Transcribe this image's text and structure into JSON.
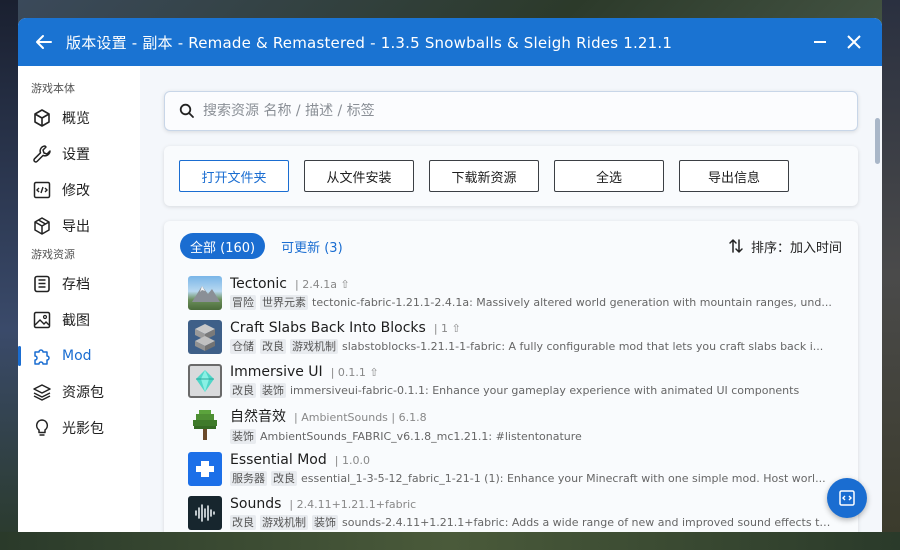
{
  "window": {
    "title": "版本设置 - 副本 - Remade & Remastered - 1.3.5 Snowballs & Sleigh Rides 1.21.1"
  },
  "colors": {
    "accent": "#1a6dd1",
    "titlebar": "#1a73d2"
  },
  "sidebar": {
    "group1": "游戏本体",
    "group2": "游戏资源",
    "items": [
      {
        "label": "概览",
        "icon": "cube-icon"
      },
      {
        "label": "设置",
        "icon": "wrench-icon"
      },
      {
        "label": "修改",
        "icon": "code-file-icon"
      },
      {
        "label": "导出",
        "icon": "box-icon"
      },
      {
        "label": "存档",
        "icon": "save-icon"
      },
      {
        "label": "截图",
        "icon": "image-icon"
      },
      {
        "label": "Mod",
        "icon": "puzzle-icon"
      },
      {
        "label": "资源包",
        "icon": "layers-icon"
      },
      {
        "label": "光影包",
        "icon": "lightbulb-icon"
      }
    ]
  },
  "search": {
    "placeholder": "搜索资源 名称 / 描述 / 标签"
  },
  "toolbar": {
    "open_folder": "打开文件夹",
    "install_from_file": "从文件安装",
    "download_new": "下载新资源",
    "select_all": "全选",
    "export_info": "导出信息"
  },
  "filters": {
    "all": "全部 (160)",
    "updatable": "可更新 (3)",
    "sort": "排序：加入时间"
  },
  "mods": [
    {
      "name": "Tectonic",
      "meta": "| 2.4.1a ⇧",
      "tags": [
        "冒险",
        "世界元素"
      ],
      "desc": "tectonic-fabric-1.21.1-2.4.1a: Massively altered world generation with mountain ranges, und..."
    },
    {
      "name": "Craft Slabs Back Into Blocks",
      "meta": "| 1 ⇧",
      "tags": [
        "仓储",
        "改良",
        "游戏机制"
      ],
      "desc": "slabstoblocks-1.21.1-1-fabric: A fully configurable mod that lets you craft slabs back i..."
    },
    {
      "name": "Immersive UI",
      "meta": "| 0.1.1 ⇧",
      "tags": [
        "改良",
        "装饰"
      ],
      "desc": "immersiveui-fabric-0.1.1: Enhance your gameplay experience with animated UI components"
    },
    {
      "name": "自然音效",
      "meta": "| AmbientSounds  |  6.1.8",
      "tags": [
        "装饰"
      ],
      "desc": "AmbientSounds_FABRIC_v6.1.8_mc1.21.1: #listentonature"
    },
    {
      "name": "Essential Mod",
      "meta": "| 1.0.0",
      "tags": [
        "服务器",
        "改良"
      ],
      "desc": "essential_1-3-5-12_fabric_1-21-1 (1): Enhance your Minecraft with one simple mod. Host worl..."
    },
    {
      "name": "Sounds",
      "meta": "| 2.4.11+1.21.1+fabric",
      "tags": [
        "改良",
        "游戏机制",
        "装饰"
      ],
      "desc": "sounds-2.4.11+1.21.1+fabric: Adds a wide range of new and improved sound effects to..."
    }
  ]
}
